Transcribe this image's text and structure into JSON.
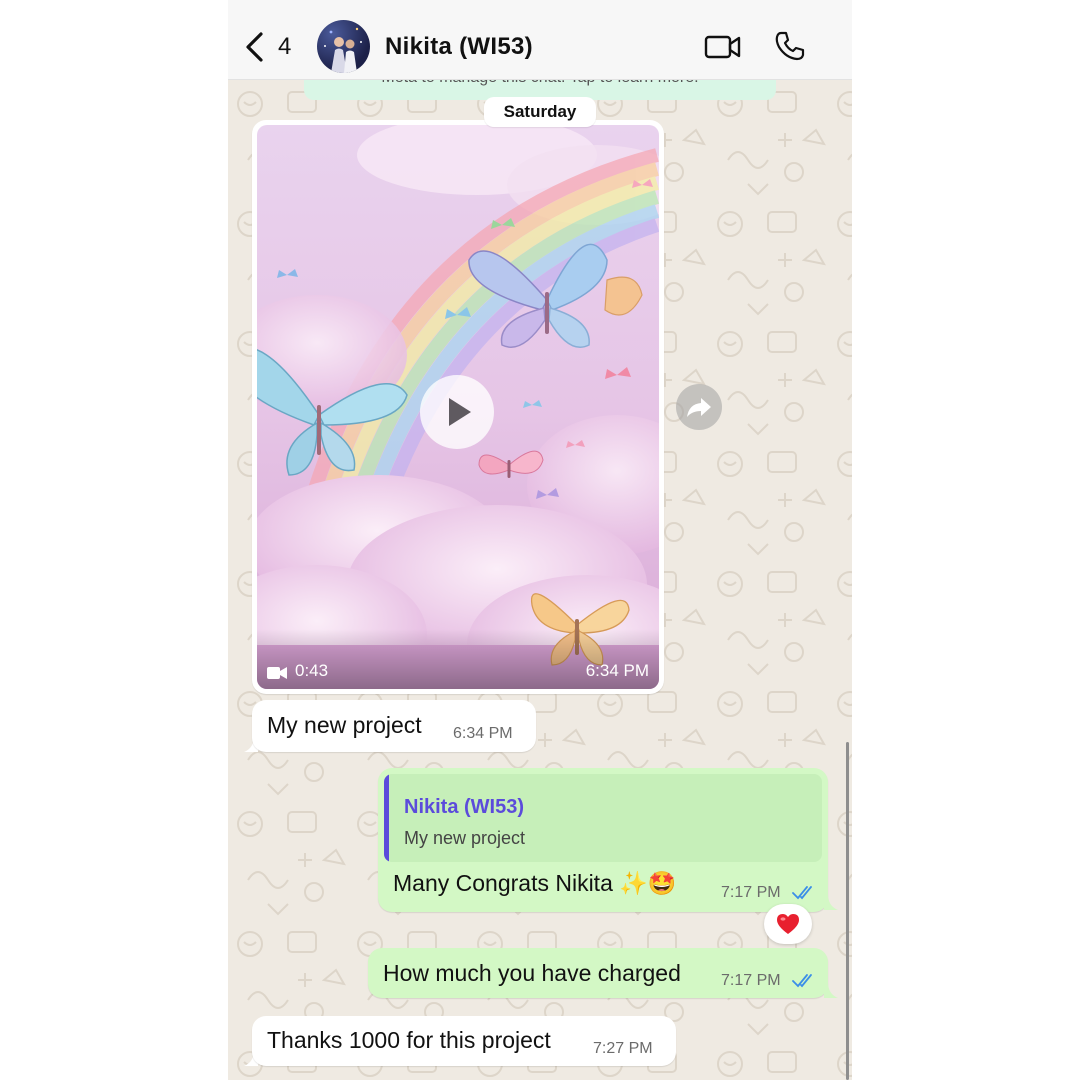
{
  "header": {
    "back_count": "4",
    "contact_name": "Nikita  (WI53)",
    "icons": [
      "back-chevron-icon",
      "video-call-icon",
      "phone-icon"
    ]
  },
  "notice": {
    "text": "Meta to manage this chat. Tap to learn more."
  },
  "date_divider": "Saturday",
  "messages": [
    {
      "type": "video",
      "direction": "incoming",
      "duration": "0:43",
      "time": "6:34 PM"
    },
    {
      "type": "text",
      "direction": "incoming",
      "text": "My new project",
      "time": "6:34 PM"
    },
    {
      "type": "text",
      "direction": "outgoing",
      "quote": {
        "author": "Nikita  (WI53)",
        "text": "My new project"
      },
      "text": "Many Congrats Nikita ✨🤩",
      "time": "7:17 PM",
      "status": "read",
      "reaction": "❤️"
    },
    {
      "type": "text",
      "direction": "outgoing",
      "text": "How much you have charged",
      "time": "7:17 PM",
      "status": "read"
    },
    {
      "type": "text",
      "direction": "incoming",
      "text": "Thanks 1000 for this project",
      "time": "7:27 PM"
    }
  ],
  "colors": {
    "outgoing_bubble": "#d3f8c5",
    "incoming_bubble": "#ffffff",
    "chat_background": "#efeae2",
    "quote_accent": "#5b4bdb",
    "read_ticks": "#3b8ee8"
  }
}
